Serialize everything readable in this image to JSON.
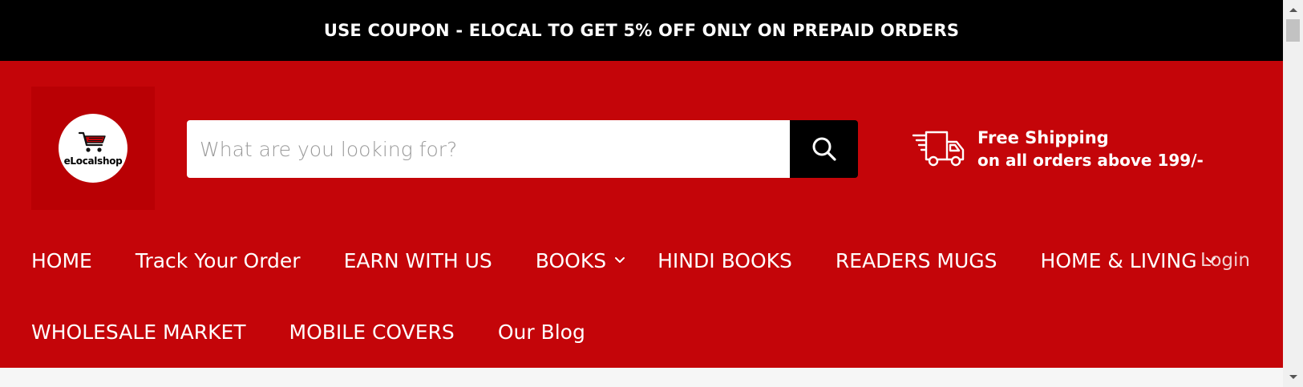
{
  "announcement": {
    "text": "USE COUPON - ELOCAL TO GET 5% OFF ONLY ON PREPAID ORDERS"
  },
  "logo": {
    "text": "eLocalshop"
  },
  "search": {
    "placeholder": "What are you looking for?",
    "value": ""
  },
  "shipping": {
    "title": "Free Shipping",
    "subtitle": "on all orders above 199/-"
  },
  "nav": {
    "row1": [
      {
        "label": "HOME"
      },
      {
        "label": "Track Your Order"
      },
      {
        "label": "EARN WITH US"
      },
      {
        "label": "BOOKS"
      },
      {
        "label": "HINDI BOOKS"
      },
      {
        "label": "READERS MUGS"
      },
      {
        "label": "HOME & LIVING"
      }
    ],
    "row2": [
      {
        "label": "WHOLESALE MARKET"
      },
      {
        "label": "MOBILE COVERS"
      },
      {
        "label": "Our Blog"
      }
    ],
    "login": "Login"
  },
  "colors": {
    "brand_red": "#c40509",
    "announcement_bg": "#000000",
    "search_button_bg": "#000000"
  }
}
